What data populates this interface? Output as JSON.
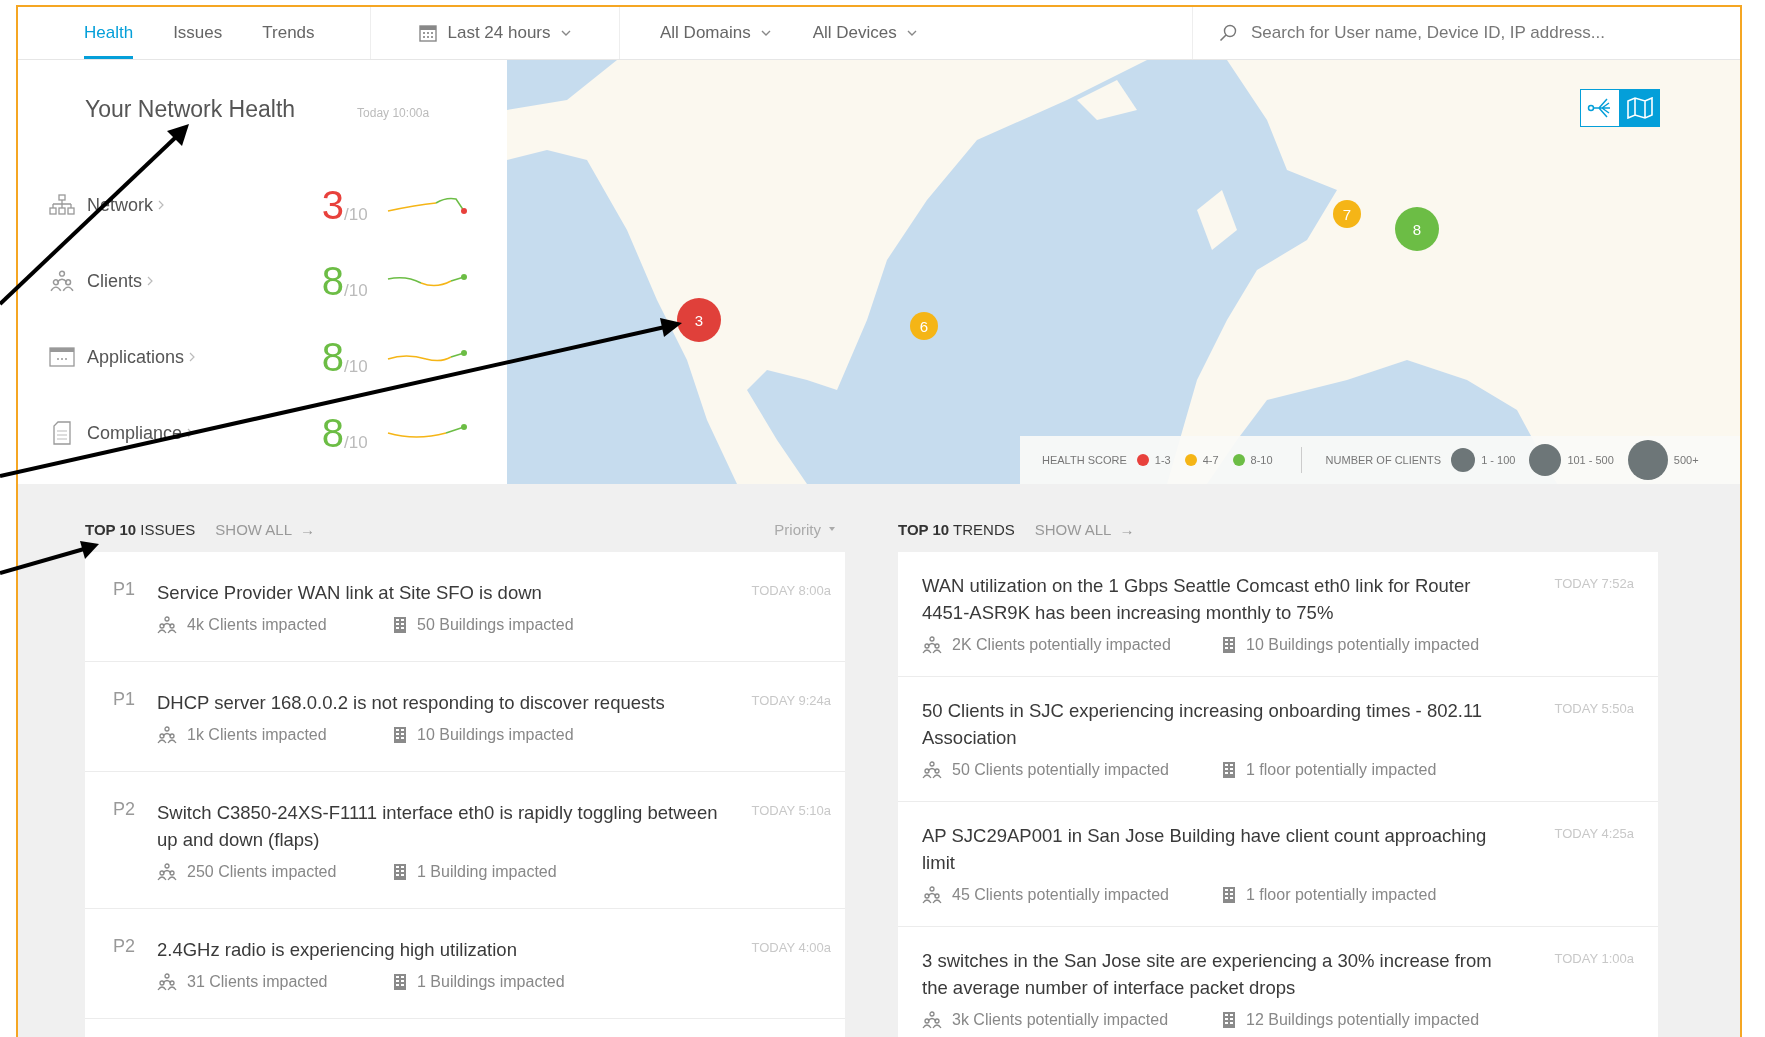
{
  "tabs": [
    {
      "label": "Health",
      "selected": true
    },
    {
      "label": "Issues",
      "selected": false
    },
    {
      "label": "Trends",
      "selected": false
    }
  ],
  "filters": [
    {
      "kind": "time",
      "label": "Last 24 hours"
    },
    {
      "kind": "plain",
      "label": "All Domains"
    },
    {
      "kind": "plain",
      "label": "All Devices"
    }
  ],
  "search": {
    "placeholder": "Search for User name, Device ID, IP address..."
  },
  "health": {
    "title": "Your Network Health",
    "timestamp": "Today 10:00a",
    "categories": [
      {
        "kind": "network",
        "name": "Network",
        "score": "3",
        "scale": "/10",
        "color": "#e8413c"
      },
      {
        "kind": "clients",
        "name": "Clients",
        "score": "8",
        "scale": "/10",
        "color": "#6cbd45"
      },
      {
        "kind": "applications",
        "name": "Applications",
        "score": "8",
        "scale": "/10",
        "color": "#6cbd45"
      },
      {
        "kind": "compliance",
        "name": "Compliance",
        "score": "8",
        "scale": "/10",
        "color": "#6cbd45"
      }
    ]
  },
  "map": {
    "markers": [
      {
        "label": "3",
        "color": "#e0403a"
      },
      {
        "label": "6",
        "color": "#f5b516"
      },
      {
        "label": "7",
        "color": "#f5b516"
      },
      {
        "label": "8",
        "color": "#6cbd45"
      }
    ],
    "views": [
      {
        "kind": "topology",
        "selected": false
      },
      {
        "kind": "map",
        "selected": true
      }
    ],
    "legend": {
      "health_label": "HEALTH SCORE",
      "health_ranges": [
        {
          "label": "1-3",
          "color": "#e8413c"
        },
        {
          "label": "4-7",
          "color": "#f5b516"
        },
        {
          "label": "8-10",
          "color": "#6cbd45"
        }
      ],
      "clients_label": "NUMBER OF CLIENTS",
      "client_ranges": [
        "1 - 100",
        "101 - 500",
        "500+"
      ]
    }
  },
  "issues": {
    "title": "**TOP 10** ISSUES",
    "show_all": "SHOW ALL",
    "show_all_arrow": "→",
    "sort": "Priority",
    "items": [
      {
        "priority": "P1",
        "title": "Service Provider WAN link at Site SFO is down",
        "time": "TODAY 8:00a",
        "clients": "4k Clients impacted",
        "buildings": "50 Buildings impacted"
      },
      {
        "priority": "P1",
        "title": "DHCP server 168.0.0.2 is not responding to discover requests",
        "time": "TODAY 9:24a",
        "clients": "1k Clients impacted",
        "buildings": "10 Buildings impacted"
      },
      {
        "priority": "P2",
        "title": "Switch C3850-24XS-F1111 interface eth0 is rapidly toggling between up and down (flaps)",
        "time": "TODAY 5:10a",
        "clients": "250 Clients impacted",
        "buildings": "1 Building impacted"
      },
      {
        "priority": "P2",
        "title": "2.4GHz radio is experiencing high utilization",
        "time": "TODAY 4:00a",
        "clients": "31 Clients impacted",
        "buildings": "1 Buildings impacted"
      }
    ]
  },
  "trends": {
    "title": "**TOP 10** TRENDS",
    "show_all": "SHOW ALL",
    "show_all_arrow": "→",
    "items": [
      {
        "title": "WAN utilization on the 1 Gbps Seattle Comcast eth0 link for Router 4451-ASR9K has been increasing monthly to 75%",
        "time": "TODAY 7:52a",
        "clients": "2K Clients potentially impacted",
        "buildings": "10 Buildings potentially impacted"
      },
      {
        "title": "50 Clients in SJC experiencing increasing onboarding times - 802.11 Association",
        "time": "TODAY 5:50a",
        "clients": "50 Clients potentially impacted",
        "buildings": "1 floor potentially impacted"
      },
      {
        "title": "AP SJC29AP001 in San Jose Building have client count approaching limit",
        "time": "TODAY 4:25a",
        "clients": "45 Clients potentially impacted",
        "buildings": "1 floor potentially impacted"
      },
      {
        "title": "3 switches in the San Jose site are experiencing a 30% increase from the average number of interface packet drops",
        "time": "TODAY 1:00a",
        "clients": "3k Clients potentially impacted",
        "buildings": "12 Buildings potentially impacted"
      }
    ]
  }
}
